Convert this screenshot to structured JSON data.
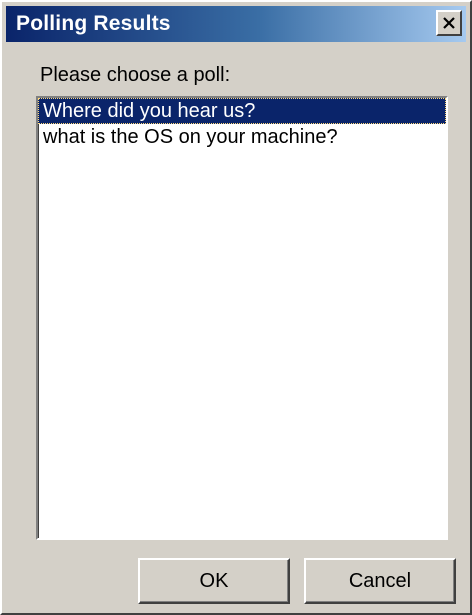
{
  "window": {
    "title": "Polling Results",
    "close_icon": "close-x-icon"
  },
  "dialog": {
    "prompt": "Please choose a poll:",
    "polls": [
      {
        "label": "Where did you hear us?",
        "selected": true
      },
      {
        "label": "what is the OS on your machine?",
        "selected": false
      }
    ]
  },
  "buttons": {
    "ok_label": "OK",
    "cancel_label": "Cancel"
  },
  "colors": {
    "title_gradient_start": "#0a246a",
    "title_gradient_end": "#a6caf0",
    "selection": "#0a246a",
    "face": "#d4d0c8"
  }
}
